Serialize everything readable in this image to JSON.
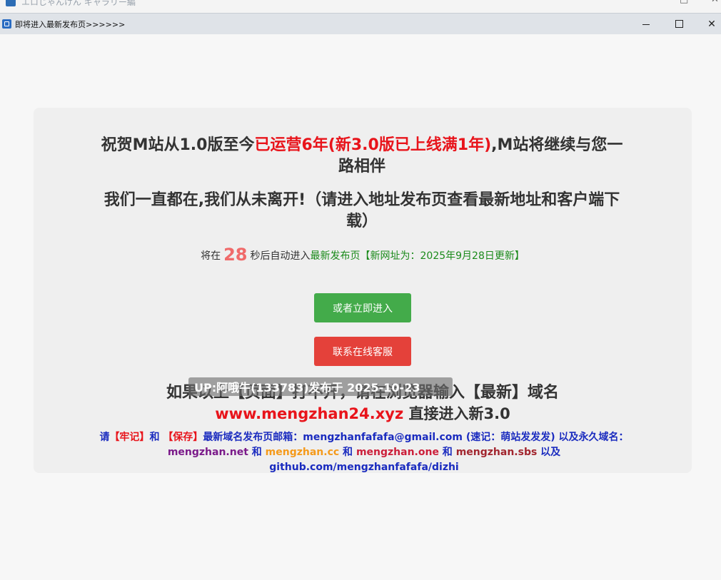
{
  "outer_window": {
    "title": "エロじゃんけん ギャラリー編"
  },
  "window": {
    "title": "即将进入最新发布页>>>>>>"
  },
  "headline1": {
    "prefix": "祝贺M站从1.0版至今",
    "highlight": "已运营6年(新3.0版已上线满1年)",
    "suffix": ",M站将继续与您一路相伴"
  },
  "headline2": "我们一直都在,我们从未离开!（请进入地址发布页查看最新地址和客户端下载）",
  "countdown": {
    "prefix": "将在",
    "seconds": "28",
    "middle": "秒后自动进入",
    "link": "最新发布页【新网址为：2025年9月28日更新】"
  },
  "buttons": {
    "enter_now": "或者立即进入",
    "contact": "联系在线客服"
  },
  "line3": "如果以上【页面】打不开，请在浏览器输入【最新】域名",
  "line4": {
    "url": "www.mengzhan24.xyz",
    "suffix": " 直接进入新3.0"
  },
  "notice": {
    "p1": "请",
    "remember": "【牢记】",
    "p2": "和 ",
    "save": "【保存】",
    "p3": "最新域名发布页邮箱：mengzhanfafafa@gmail.com (速记：萌站发发发) 以及永久域名：",
    "d1": "mengzhan.net",
    "and1": " 和 ",
    "d2": "mengzhan.cc",
    "and2": " 和 ",
    "d3": "mengzhan.one",
    "and3": " 和 ",
    "d4": "mengzhan.sbs",
    "p4": " 以及 github.com/mengzhanfafafa/dizhi"
  },
  "overlay": "UP:阿哦牛(133783)发布于 2025-10-23",
  "colors": {
    "accent_red": "#e8141b",
    "button_green": "#43ab4a",
    "button_red": "#e4413a",
    "link_blue": "#1a2bbf",
    "countdown": "#f06a6a"
  },
  "icons": {
    "window_icon": "app-icon",
    "minimize": "minimize-icon",
    "maximize": "maximize-icon",
    "close": "close-icon"
  }
}
